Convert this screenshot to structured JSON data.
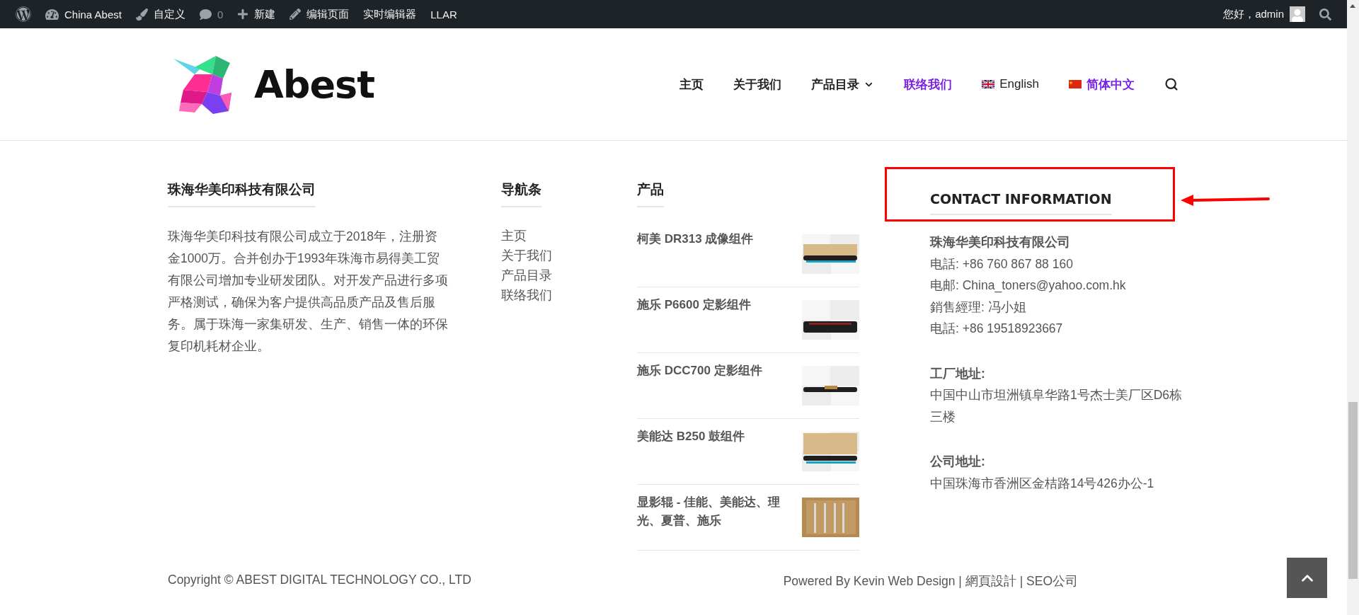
{
  "admin_bar": {
    "items": [
      {
        "kind": "wordpress"
      },
      {
        "kind": "dashboard",
        "label": "China Abest"
      },
      {
        "kind": "brush",
        "label": "自定义"
      },
      {
        "kind": "comments",
        "label": "0"
      },
      {
        "kind": "plus",
        "label": "新建"
      },
      {
        "kind": "pencil",
        "label": "编辑页面"
      },
      {
        "kind": "text",
        "label": "实时编辑器"
      },
      {
        "kind": "text",
        "label": "LLAR"
      }
    ],
    "greeting": "您好，admin"
  },
  "header": {
    "logo": "Abest",
    "nav": [
      {
        "label": "主页",
        "selected": false,
        "has_dropdown": false
      },
      {
        "label": "关于我们",
        "selected": false,
        "has_dropdown": false
      },
      {
        "label": "产品目录",
        "selected": false,
        "has_dropdown": true
      },
      {
        "label": "联络我们",
        "selected": true,
        "has_dropdown": false
      }
    ],
    "languages": [
      {
        "label": "English",
        "kind": "uk",
        "selected": false
      },
      {
        "label": "简体中文",
        "kind": "cn",
        "selected": true
      }
    ]
  },
  "footer": {
    "company": {
      "title": "珠海华美印科技有限公司",
      "text": "珠海华美印科技有限公司成立于2018年，注册资金1000万。合并创办于1993年珠海市易得美工贸有限公司增加专业研发团队。对开发产品进行多项严格测试，确保为客户提供高品质产品及售后服务。属于珠海一家集研发、生产、销售一体的环保复印机耗材企业。"
    },
    "navigation": {
      "title": "导航条",
      "links": [
        "主页",
        "关于我们",
        "产品目录",
        "联络我们"
      ]
    },
    "products": {
      "title": "产品",
      "items": [
        {
          "name": "柯美 DR313 成像组件"
        },
        {
          "name": "施乐 P6600 定影组件"
        },
        {
          "name": "施乐 DCC700 定影组件"
        },
        {
          "name": "美能达 B250 鼓组件"
        },
        {
          "name": "显影辊 - 佳能、美能达、理光、夏普、施乐"
        }
      ]
    },
    "contact": {
      "title": "CONTACT INFORMATION",
      "highlighted": true,
      "company": "珠海华美印科技有限公司",
      "lines": [
        "电話: +86 760 867 88 160",
        "电邮: China_toners@yahoo.com.hk",
        "銷售經理: 冯小姐",
        "电話: +86 19518923667"
      ],
      "sections": [
        {
          "title": "工厂地址:",
          "text": "中国中山市坦洲镇阜华路1号杰士美厂区D6栋三楼"
        },
        {
          "title": "公司地址:",
          "text": "中国珠海市香洲区金桔路14号426办公-1"
        }
      ]
    },
    "copyright": "Copyright © ABEST DIGITAL TECHNOLOGY CO., LTD",
    "credit": "Powered By Kevin Web Design | 網頁設計 | SEO公司"
  }
}
